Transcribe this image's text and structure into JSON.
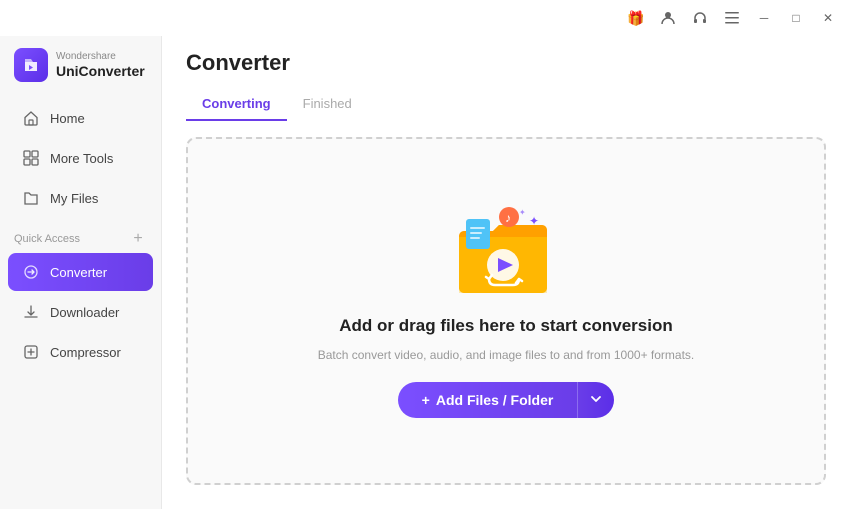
{
  "titlebar": {
    "icons": [
      {
        "name": "gift-icon",
        "symbol": "🎁",
        "class": "gift"
      },
      {
        "name": "user-icon",
        "symbol": "👤",
        "class": "user"
      },
      {
        "name": "headphone-icon",
        "symbol": "🎧",
        "class": "headphone"
      },
      {
        "name": "menu-icon",
        "symbol": "☰",
        "class": ""
      },
      {
        "name": "minimize-icon",
        "symbol": "─",
        "class": "win-btn"
      },
      {
        "name": "maximize-icon",
        "symbol": "□",
        "class": "win-btn"
      },
      {
        "name": "close-icon",
        "symbol": "✕",
        "class": "close win-btn"
      }
    ]
  },
  "sidebar": {
    "brand": "Wondershare",
    "app_name": "UniConverter",
    "nav_items": [
      {
        "id": "home",
        "label": "Home",
        "icon": "⌂",
        "active": false
      },
      {
        "id": "more-tools",
        "label": "More Tools",
        "icon": "⊞",
        "active": false
      },
      {
        "id": "my-files",
        "label": "My Files",
        "icon": "📄",
        "active": false
      },
      {
        "id": "converter",
        "label": "Converter",
        "icon": "↔",
        "active": true
      },
      {
        "id": "downloader",
        "label": "Downloader",
        "icon": "⬇",
        "active": false
      },
      {
        "id": "compressor",
        "label": "Compressor",
        "icon": "⊟",
        "active": false
      }
    ],
    "quick_access_label": "Quick Access"
  },
  "main": {
    "page_title": "Converter",
    "tabs": [
      {
        "id": "converting",
        "label": "Converting",
        "active": true
      },
      {
        "id": "finished",
        "label": "Finished",
        "active": false
      }
    ],
    "drop_zone": {
      "title": "Add or drag files here to start conversion",
      "subtitle": "Batch convert video, audio, and image files to and from 1000+ formats.",
      "button_label": "Add Files / Folder",
      "button_plus": "+"
    }
  }
}
